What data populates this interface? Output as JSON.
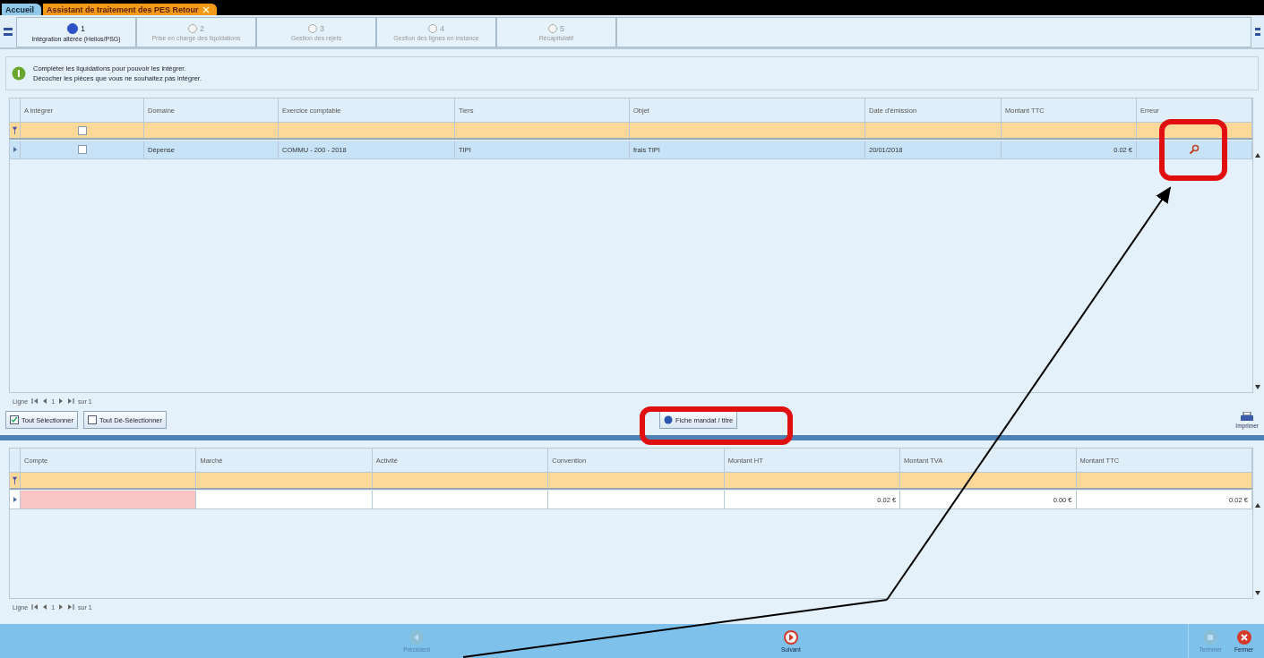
{
  "tabs": [
    {
      "label": "Accueil",
      "selected": false,
      "closable": false
    },
    {
      "label": "Assistant de traitement des PES Retour",
      "selected": true,
      "closable": true
    }
  ],
  "steps": [
    {
      "number": "1",
      "label": "Intégration altérée (Helios/PSG)",
      "selected": true,
      "disabled": false
    },
    {
      "number": "2",
      "label": "Prise en charge des liquidations",
      "selected": false,
      "disabled": true
    },
    {
      "number": "3",
      "label": "Gestion des rejets",
      "selected": false,
      "disabled": true
    },
    {
      "number": "4",
      "label": "Gestion des lignes en instance",
      "selected": false,
      "disabled": true
    },
    {
      "number": "5",
      "label": "Récapitulatif",
      "selected": false,
      "disabled": true
    }
  ],
  "info": {
    "lines": [
      "Compléter les liquidations pour pouvoir les intégrer.",
      "Décocher les pièces que vous ne souhaitez pas intégrer."
    ]
  },
  "pieces_table": {
    "columns": [
      "A intégrer",
      "Domaine",
      "Exercice comptable",
      "Tiers",
      "Objet",
      "Date d'émission",
      "Montant TTC",
      "Erreur"
    ],
    "filter": {
      "checked": false
    },
    "rows": [
      {
        "checked": false,
        "cells": [
          "",
          "Dépense",
          "COMMU - 200 - 2018",
          "TIPI",
          "frais TIPI",
          "20/01/2018",
          "0.02 €",
          ""
        ],
        "error": true
      }
    ],
    "pager": {
      "label": "Ligne",
      "page": "1",
      "of": "sur 1"
    }
  },
  "actions": {
    "select_all": "Tout Sélectionner",
    "deselect_all": "Tout Dé-Sélectionner",
    "fiche": "Fiche mandat / titre",
    "print": "Imprimer"
  },
  "imputation_table": {
    "columns": [
      "Compte",
      "Marché",
      "Activité",
      "Convention",
      "Montant HT",
      "Montant TVA",
      "Montant TTC"
    ],
    "rows": [
      {
        "cells": [
          "",
          "",
          "",
          "",
          "0.02 €",
          "0.00 €",
          "0.02 €"
        ],
        "invalid": [
          true,
          false,
          false,
          false,
          false,
          false,
          false
        ]
      }
    ],
    "pager": {
      "label": "Ligne",
      "page": "1",
      "of": "sur 1"
    }
  },
  "footer": [
    {
      "label": "Précédent",
      "kind": "previous",
      "disabled": true
    },
    {
      "label": "Suivant",
      "kind": "next",
      "disabled": false
    },
    {
      "label": "Terminer",
      "kind": "finish",
      "disabled": true
    },
    {
      "label": "Fermer",
      "kind": "close",
      "disabled": false
    }
  ]
}
